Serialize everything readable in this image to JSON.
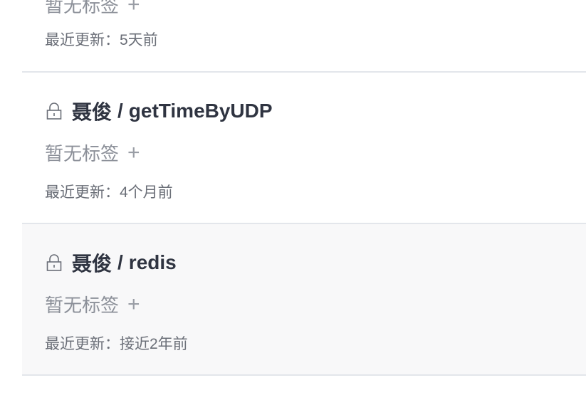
{
  "repos": [
    {
      "tags_text": "暂无标签",
      "add_tag": "+",
      "updated_prefix": "最近更新：",
      "updated_value": "5天前"
    },
    {
      "owner": "聂俊",
      "separator": "/",
      "name": "getTimeByUDP",
      "tags_text": "暂无标签",
      "add_tag": "+",
      "updated_prefix": "最近更新：",
      "updated_value": "4个月前"
    },
    {
      "owner": "聂俊",
      "separator": "/",
      "name": "redis",
      "tags_text": "暂无标签",
      "add_tag": "+",
      "updated_prefix": "最近更新：",
      "updated_value": "接近2年前"
    }
  ],
  "icons": {
    "lock": "lock-icon"
  },
  "colors": {
    "title": "#2f3441",
    "muted": "#8c9099",
    "divider": "#e3e6eb",
    "hover_bg": "#f8f8f9"
  }
}
